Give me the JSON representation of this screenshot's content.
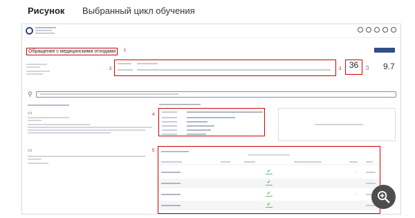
{
  "caption": {
    "prefix": "Рисунок",
    "text": "Выбранный цикл обучения"
  },
  "page": {
    "title": "Обращение с медицинскими отходами"
  },
  "stats": {
    "count": "36",
    "percent": "9.7"
  },
  "markers": [
    "1",
    "2",
    "3",
    "4",
    "5"
  ],
  "table": {
    "rows": 4
  },
  "icons": [
    "search-icon",
    "zoom-in-icon",
    "check-icon",
    "device-icon",
    "book-icon"
  ]
}
